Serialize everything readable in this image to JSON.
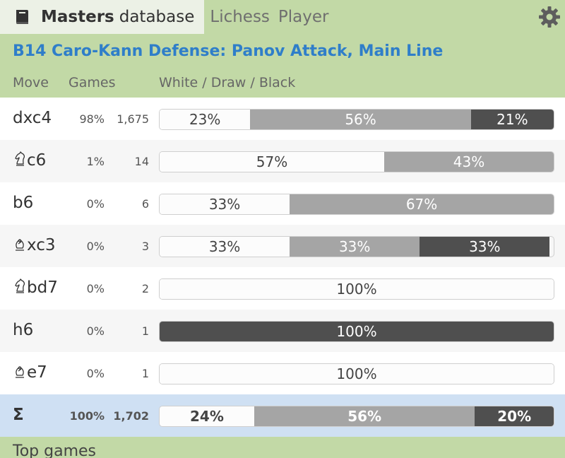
{
  "tabs": {
    "active_bold": "Masters",
    "active_rest": "database",
    "lichess": "Lichess",
    "player": "Player"
  },
  "opening": "B14 Caro-Kann Defense: Panov Attack, Main Line",
  "header": {
    "move": "Move",
    "games": "Games",
    "result": "White / Draw / Black"
  },
  "rows": [
    {
      "piece": "",
      "move": "dxc4",
      "pct": "98%",
      "games": "1,675",
      "white": 23,
      "draw": 56,
      "black": 21,
      "white_label": "23%",
      "draw_label": "56%",
      "black_label": "21%"
    },
    {
      "piece": "knight",
      "move": "c6",
      "pct": "1%",
      "games": "14",
      "white": 57,
      "draw": 43,
      "black": 0,
      "white_label": "57%",
      "draw_label": "43%",
      "black_label": ""
    },
    {
      "piece": "",
      "move": "b6",
      "pct": "0%",
      "games": "6",
      "white": 33,
      "draw": 67,
      "black": 0,
      "white_label": "33%",
      "draw_label": "67%",
      "black_label": ""
    },
    {
      "piece": "bishop",
      "move": "xc3",
      "pct": "0%",
      "games": "3",
      "white": 33,
      "draw": 33,
      "black": 33,
      "white_label": "33%",
      "draw_label": "33%",
      "black_label": "33%"
    },
    {
      "piece": "knight",
      "move": "bd7",
      "pct": "0%",
      "games": "2",
      "white": 100,
      "draw": 0,
      "black": 0,
      "white_label": "100%",
      "draw_label": "",
      "black_label": ""
    },
    {
      "piece": "",
      "move": "h6",
      "pct": "0%",
      "games": "1",
      "white": 0,
      "draw": 0,
      "black": 100,
      "white_label": "",
      "draw_label": "",
      "black_label": "100%"
    },
    {
      "piece": "bishop",
      "move": "e7",
      "pct": "0%",
      "games": "1",
      "white": 100,
      "draw": 0,
      "black": 0,
      "white_label": "100%",
      "draw_label": "",
      "black_label": ""
    }
  ],
  "sum": {
    "symbol": "Σ",
    "pct": "100%",
    "games": "1,702",
    "white": 24,
    "draw": 56,
    "black": 20,
    "white_label": "24%",
    "draw_label": "56%",
    "black_label": "20%"
  },
  "footer": "Top games",
  "colors": {
    "header_green": "#c2d9a6",
    "link_blue": "#2f7ec9",
    "sum_blue": "#cfe0f3",
    "draw_gray": "#a5a5a5",
    "black_gray": "#4f4f4f"
  },
  "icons": {
    "book": "book-icon",
    "settings": "gear-icon",
    "knight": "knight-icon",
    "bishop": "bishop-icon"
  }
}
